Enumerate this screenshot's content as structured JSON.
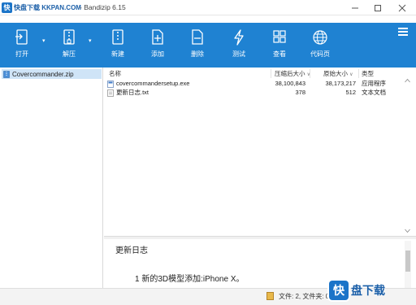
{
  "watermark": {
    "badge": "快",
    "text": "快盘下载 KKPAN.COM"
  },
  "window": {
    "title": "- Bandizip 6.15"
  },
  "toolbar": {
    "buttons": [
      {
        "label": "打开",
        "icon": "open-icon"
      },
      {
        "label": "解压",
        "icon": "extract-icon"
      },
      {
        "label": "新建",
        "icon": "new-archive-icon"
      },
      {
        "label": "添加",
        "icon": "add-icon"
      },
      {
        "label": "删除",
        "icon": "delete-icon"
      },
      {
        "label": "测试",
        "icon": "test-icon"
      },
      {
        "label": "查看",
        "icon": "view-icon"
      },
      {
        "label": "代码页",
        "icon": "codepage-icon"
      }
    ]
  },
  "tree": {
    "archive": "Covercommander.zip"
  },
  "filelist": {
    "columns": {
      "name": "名称",
      "packed": "压缩后大小",
      "original": "原始大小",
      "type": "类型"
    },
    "rows": [
      {
        "name": "covercommandersetup.exe",
        "packed": "38,100,843",
        "original": "38,173,217",
        "type": "应用程序"
      },
      {
        "name": "更新日志.txt",
        "packed": "378",
        "original": "512",
        "type": "文本文档"
      }
    ]
  },
  "preview": {
    "title": "更新日志",
    "line": "1 新的3D模型添加:iPhone X。"
  },
  "status": {
    "text": "文件: 2, 文件夹: 0"
  },
  "bottom_watermark": {
    "badge": "快",
    "text": "盘下载"
  },
  "colors": {
    "toolbar": "#1f82d2",
    "selection": "#cfe4f7"
  }
}
